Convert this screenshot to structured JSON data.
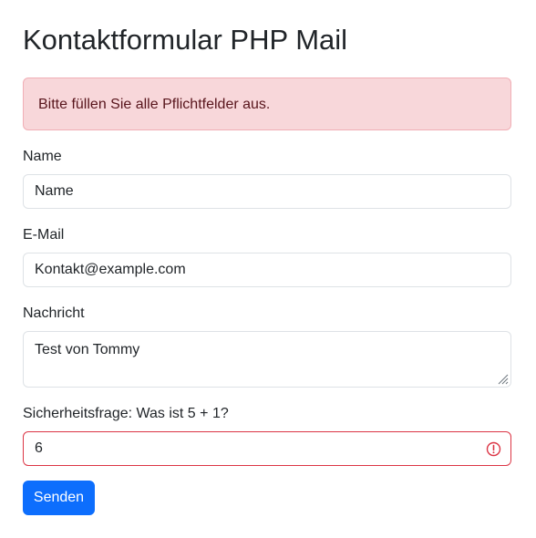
{
  "page": {
    "title": "Kontaktformular PHP Mail"
  },
  "alert": {
    "message": "Bitte füllen Sie alle Pflichtfelder aus.",
    "type": "danger"
  },
  "form": {
    "name": {
      "label": "Name",
      "value": "Name"
    },
    "email": {
      "label": "E-Mail",
      "value": "Kontakt@example.com"
    },
    "message": {
      "label": "Nachricht",
      "value": "Test von Tommy"
    },
    "captcha": {
      "label": "Sicherheitsfrage: Was ist 5 + 1?",
      "value": "6",
      "state": "invalid"
    },
    "submit_label": "Senden"
  },
  "colors": {
    "primary": "#0d6efd",
    "danger": "#dc3545",
    "alert_bg": "#f8d7da",
    "alert_text": "#58151c"
  },
  "icons": {
    "invalid": "exclamation-circle-icon",
    "resize": "resize-grip-icon"
  }
}
